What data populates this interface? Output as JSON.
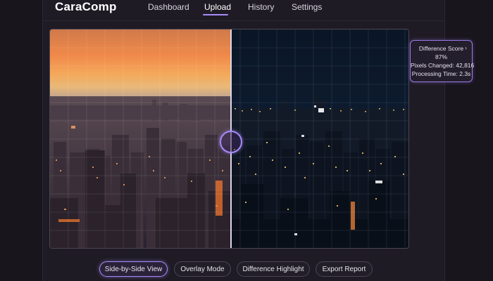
{
  "app": {
    "brand": "CaraComp"
  },
  "nav": {
    "items": [
      {
        "label": "Dashboard"
      },
      {
        "label": "Upload",
        "active": true
      },
      {
        "label": "History"
      },
      {
        "label": "Settings"
      }
    ]
  },
  "viewer": {
    "left_image": "city-at-sunset",
    "right_image": "city-at-night",
    "handle_icon": "slider-handle-icon"
  },
  "score_card": {
    "title": "Difference Score",
    "score": "87%",
    "pixels_changed": "Pixels Changed: 42,816",
    "processing_time": "Processing Time: 2.3s",
    "chevron_icon": "chevron-right-icon"
  },
  "toolbar": {
    "side_by_side": "Side-by-Side View",
    "overlay": "Overlay Mode",
    "difference": "Difference Highlight",
    "export": "Export Report"
  },
  "colors": {
    "accent": "#a78bfa",
    "background": "#18151c",
    "panel": "#1f1b24"
  }
}
